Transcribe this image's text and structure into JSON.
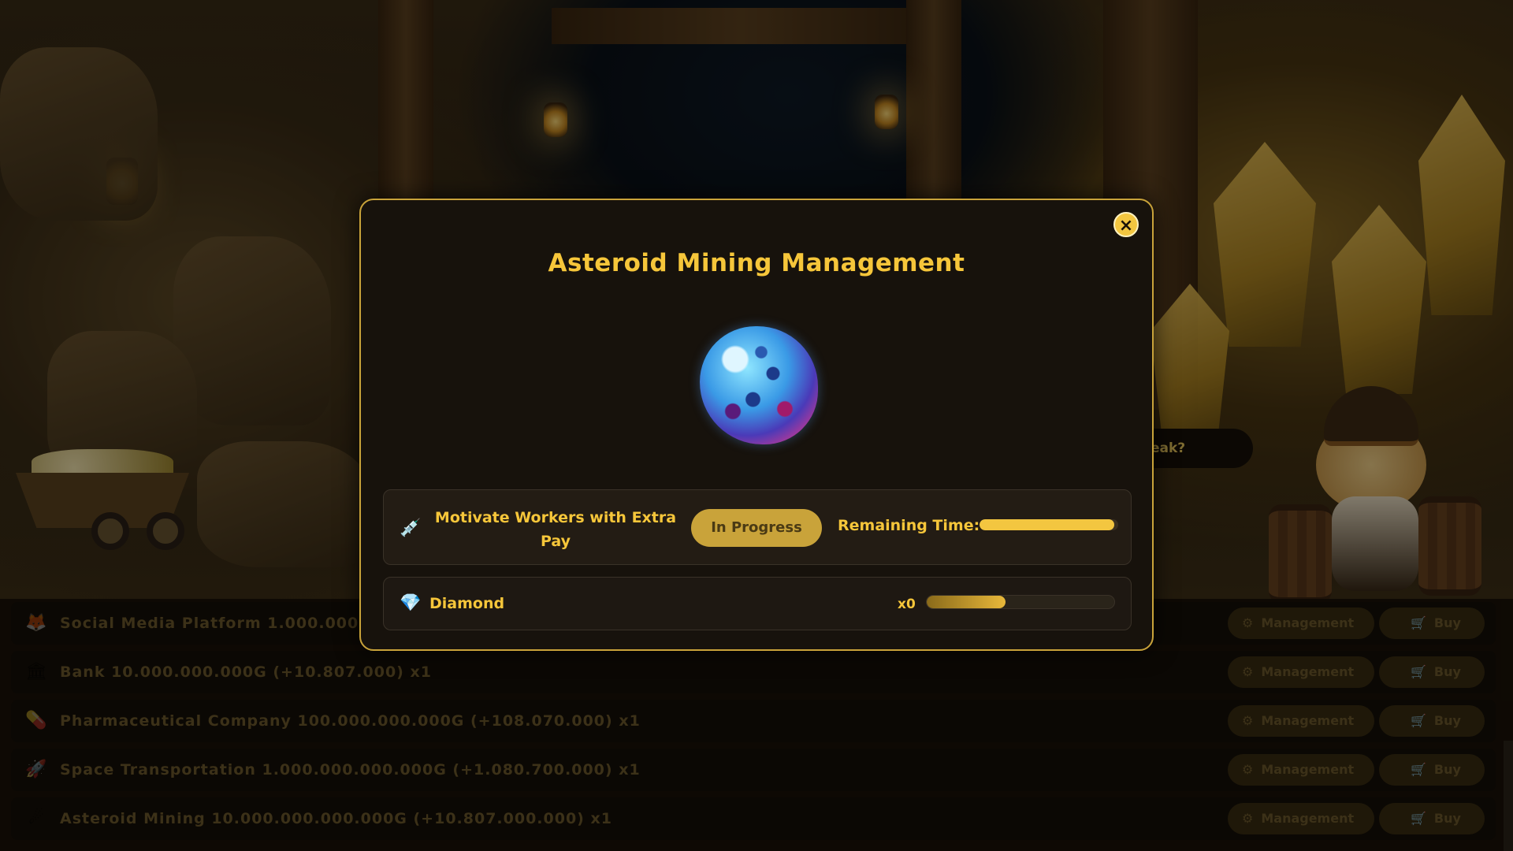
{
  "background": {
    "tip_text": "eak?"
  },
  "businesses": [
    {
      "icon": "fox-icon",
      "glyph": "🦊",
      "text": "Social Media Platform 1.000.000.0"
    },
    {
      "icon": "bank-icon",
      "glyph": "🏛",
      "text": "Bank 10.000.000.000G (+10.807.000) x1"
    },
    {
      "icon": "pill-icon",
      "glyph": "💊",
      "text": "Pharmaceutical Company 100.000.000.000G (+108.070.000) x1"
    },
    {
      "icon": "rocket-icon",
      "glyph": "🚀",
      "text": "Space Transportation 1.000.000.000.000G (+1.080.700.000) x1"
    },
    {
      "icon": "asteroid-icon",
      "glyph": "☄",
      "text": "Asteroid Mining 10.000.000.000.000G (+10.807.000.000) x1"
    }
  ],
  "row_buttons": {
    "management_label": "Management",
    "management_icon": "gear-icon",
    "buy_label": "Buy",
    "buy_icon": "cart-icon"
  },
  "modal": {
    "title": "Asteroid Mining Management",
    "close_glyph": "×",
    "image": "asteroid-image",
    "task": {
      "icon": "syringe-icon",
      "label": "Motivate Workers with Extra Pay",
      "status_button": "In Progress",
      "remaining_label": "Remaining Time:",
      "remaining_fraction": 0.97
    },
    "resource": {
      "icon": "diamond-icon",
      "name": "Diamond",
      "count": "x0",
      "progress_fraction": 0.42
    }
  },
  "colors": {
    "accent": "#f6c63a",
    "modal_border": "#c9a33a",
    "modal_bg": "#17120c"
  }
}
